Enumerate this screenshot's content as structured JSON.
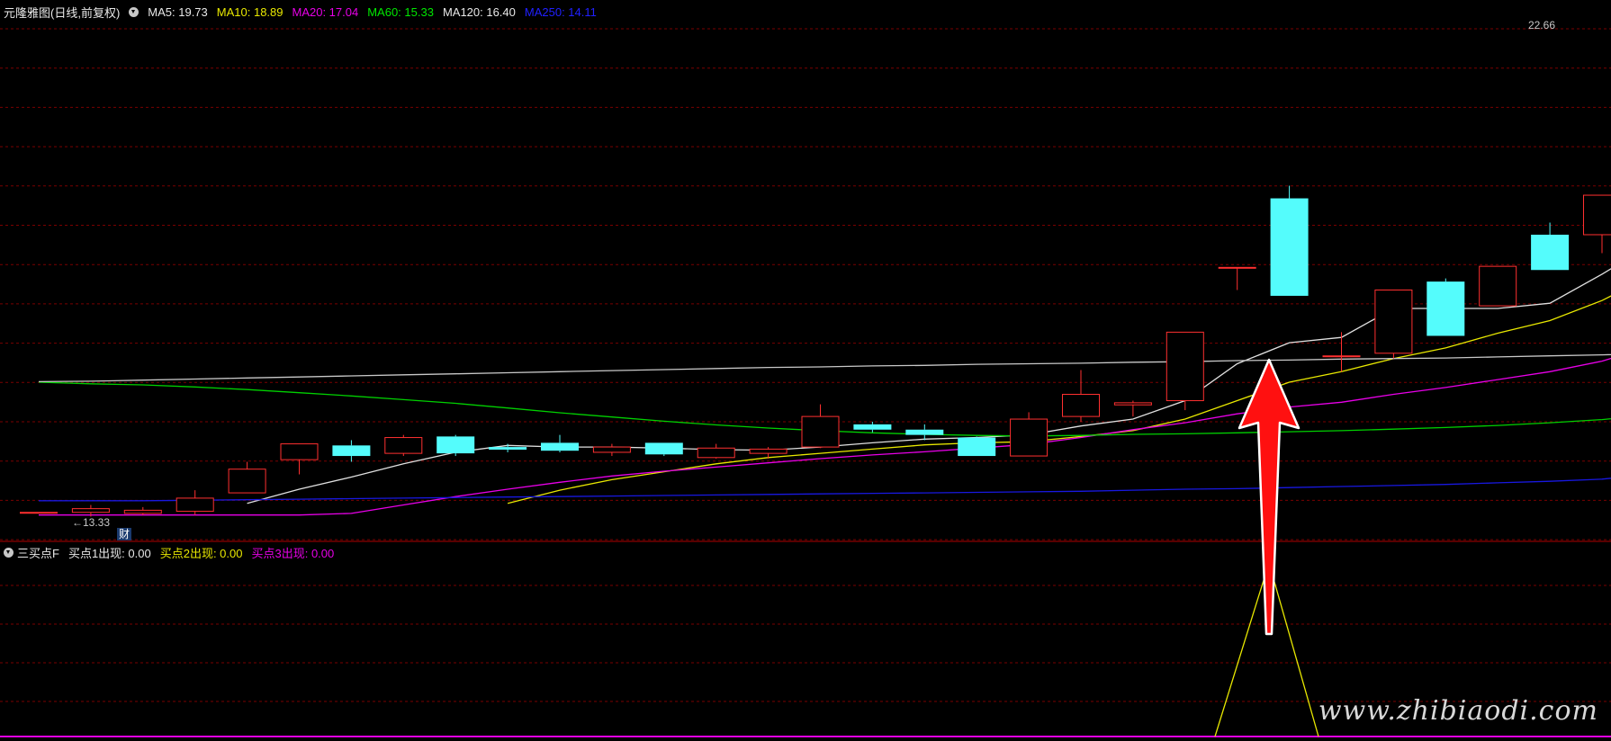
{
  "main_panel": {
    "title": "元隆雅图(日线,前复权)",
    "indicators": [
      {
        "label": "MA5: 19.73",
        "color": "#e8e8e8"
      },
      {
        "label": "MA10: 18.89",
        "color": "#e8e800"
      },
      {
        "label": "MA20: 17.04",
        "color": "#e800e8"
      },
      {
        "label": "MA60: 15.33",
        "color": "#00e800"
      },
      {
        "label": "MA120: 16.40",
        "color": "#e8e8e8"
      },
      {
        "label": "MA250: 14.11",
        "color": "#2020ff"
      }
    ],
    "high_label": "22.66",
    "low_label": "←13.33",
    "finance_badge": "财"
  },
  "sub_panel": {
    "title": "三买点F",
    "indicators": [
      {
        "label": "买点1出现: 0.00",
        "color": "#e8e8e8"
      },
      {
        "label": "买点2出现: 0.00",
        "color": "#e8e800"
      },
      {
        "label": "买点3出现: 0.00",
        "color": "#e800e8"
      }
    ]
  },
  "watermark": "www.zhibiaodi.com",
  "colors": {
    "up": "#ff3030",
    "down": "#54fcfc",
    "grid": "#7a0000",
    "arrow": "#ff1010"
  },
  "chart_data": {
    "type": "candlestick",
    "ylim": [
      13.0,
      22.9
    ],
    "candles": [
      {
        "o": 13.38,
        "c": 13.38,
        "h": 13.38,
        "l": 13.38
      },
      {
        "o": 13.38,
        "c": 13.45,
        "h": 13.52,
        "l": 13.3
      },
      {
        "o": 13.36,
        "c": 13.42,
        "h": 13.48,
        "l": 13.33
      },
      {
        "o": 13.4,
        "c": 13.65,
        "h": 13.8,
        "l": 13.33
      },
      {
        "o": 13.75,
        "c": 14.2,
        "h": 14.34,
        "l": 13.75
      },
      {
        "o": 14.38,
        "c": 14.68,
        "h": 14.68,
        "l": 14.1
      },
      {
        "o": 14.65,
        "c": 14.45,
        "h": 14.75,
        "l": 14.34
      },
      {
        "o": 14.5,
        "c": 14.8,
        "h": 14.85,
        "l": 14.45
      },
      {
        "o": 14.82,
        "c": 14.5,
        "h": 14.85,
        "l": 14.45
      },
      {
        "o": 14.62,
        "c": 14.57,
        "h": 14.68,
        "l": 14.52
      },
      {
        "o": 14.7,
        "c": 14.55,
        "h": 14.85,
        "l": 14.52
      },
      {
        "o": 14.52,
        "c": 14.62,
        "h": 14.68,
        "l": 14.45
      },
      {
        "o": 14.7,
        "c": 14.48,
        "h": 14.7,
        "l": 14.45
      },
      {
        "o": 14.42,
        "c": 14.6,
        "h": 14.68,
        "l": 14.4
      },
      {
        "o": 14.5,
        "c": 14.58,
        "h": 14.62,
        "l": 14.4
      },
      {
        "o": 14.62,
        "c": 15.2,
        "h": 15.43,
        "l": 14.6
      },
      {
        "o": 15.05,
        "c": 14.95,
        "h": 15.1,
        "l": 14.9
      },
      {
        "o": 14.95,
        "c": 14.85,
        "h": 15.05,
        "l": 14.75
      },
      {
        "o": 14.8,
        "c": 14.45,
        "h": 14.82,
        "l": 14.45
      },
      {
        "o": 14.45,
        "c": 15.15,
        "h": 15.28,
        "l": 14.45
      },
      {
        "o": 15.2,
        "c": 15.62,
        "h": 16.08,
        "l": 15.1
      },
      {
        "o": 15.42,
        "c": 15.46,
        "h": 15.5,
        "l": 15.2
      },
      {
        "o": 15.5,
        "c": 16.8,
        "h": 16.8,
        "l": 15.32
      },
      {
        "o": 18.03,
        "c": 18.03,
        "h": 18.03,
        "l": 17.6
      },
      {
        "o": 19.34,
        "c": 17.49,
        "h": 19.58,
        "l": 17.49
      },
      {
        "o": 16.35,
        "c": 16.35,
        "h": 16.8,
        "l": 16.05
      },
      {
        "o": 16.4,
        "c": 17.6,
        "h": 17.6,
        "l": 16.3
      },
      {
        "o": 17.76,
        "c": 16.73,
        "h": 17.82,
        "l": 16.73
      },
      {
        "o": 17.3,
        "c": 18.05,
        "h": 18.05,
        "l": 17.3
      },
      {
        "o": 18.65,
        "c": 17.98,
        "h": 18.88,
        "l": 17.98
      },
      {
        "o": 18.65,
        "c": 19.4,
        "h": 19.4,
        "l": 18.3
      },
      {
        "o": 21.55,
        "c": 22.43,
        "h": 22.66,
        "l": 21.55
      }
    ],
    "ma": [
      {
        "name": "MA5",
        "color": "#e0e0e0",
        "values": [
          null,
          null,
          null,
          null,
          13.55,
          13.82,
          14.05,
          14.3,
          14.52,
          14.65,
          14.62,
          14.62,
          14.6,
          14.57,
          14.56,
          14.62,
          14.7,
          14.77,
          14.8,
          14.85,
          15.02,
          15.15,
          15.5,
          16.2,
          16.6,
          16.7,
          17.25,
          17.25,
          17.25,
          17.35,
          17.9,
          18.5
        ]
      },
      {
        "name": "MA10",
        "color": "#e8e800",
        "values": [
          null,
          null,
          null,
          null,
          null,
          null,
          null,
          null,
          null,
          13.55,
          13.8,
          14.0,
          14.15,
          14.3,
          14.42,
          14.5,
          14.58,
          14.66,
          14.7,
          14.72,
          14.82,
          14.93,
          15.15,
          15.5,
          15.85,
          16.05,
          16.3,
          16.5,
          16.78,
          17.02,
          17.4,
          17.9
        ]
      },
      {
        "name": "MA20",
        "color": "#e800e8",
        "values": [
          13.33,
          13.33,
          13.33,
          13.33,
          13.33,
          13.33,
          13.36,
          13.52,
          13.68,
          13.82,
          13.95,
          14.07,
          14.16,
          14.24,
          14.32,
          14.4,
          14.47,
          14.53,
          14.6,
          14.67,
          14.8,
          14.95,
          15.08,
          15.25,
          15.38,
          15.47,
          15.62,
          15.75,
          15.9,
          16.05,
          16.25,
          16.55
        ]
      },
      {
        "name": "MA60",
        "color": "#00d000",
        "values": [
          15.85,
          15.82,
          15.8,
          15.76,
          15.71,
          15.65,
          15.59,
          15.52,
          15.45,
          15.36,
          15.27,
          15.19,
          15.11,
          15.04,
          14.98,
          14.93,
          14.89,
          14.86,
          14.84,
          14.83,
          14.84,
          14.86,
          14.87,
          14.89,
          14.91,
          14.93,
          14.96,
          14.99,
          15.03,
          15.08,
          15.14,
          15.24
        ]
      },
      {
        "name": "MA120",
        "color": "#c8c8c8",
        "values": [
          15.86,
          15.87,
          15.89,
          15.91,
          15.93,
          15.95,
          15.97,
          15.99,
          16.01,
          16.03,
          16.05,
          16.07,
          16.09,
          16.11,
          16.13,
          16.14,
          16.16,
          16.17,
          16.19,
          16.2,
          16.21,
          16.23,
          16.24,
          16.26,
          16.27,
          16.29,
          16.3,
          16.31,
          16.33,
          16.35,
          16.37,
          16.4
        ]
      },
      {
        "name": "MA250",
        "color": "#1818e0",
        "values": [
          13.6,
          13.6,
          13.6,
          13.61,
          13.62,
          13.63,
          13.64,
          13.65,
          13.66,
          13.67,
          13.68,
          13.69,
          13.7,
          13.71,
          13.72,
          13.73,
          13.74,
          13.75,
          13.76,
          13.77,
          13.78,
          13.8,
          13.82,
          13.83,
          13.85,
          13.87,
          13.89,
          13.91,
          13.94,
          13.97,
          14.01,
          14.11
        ]
      }
    ]
  }
}
